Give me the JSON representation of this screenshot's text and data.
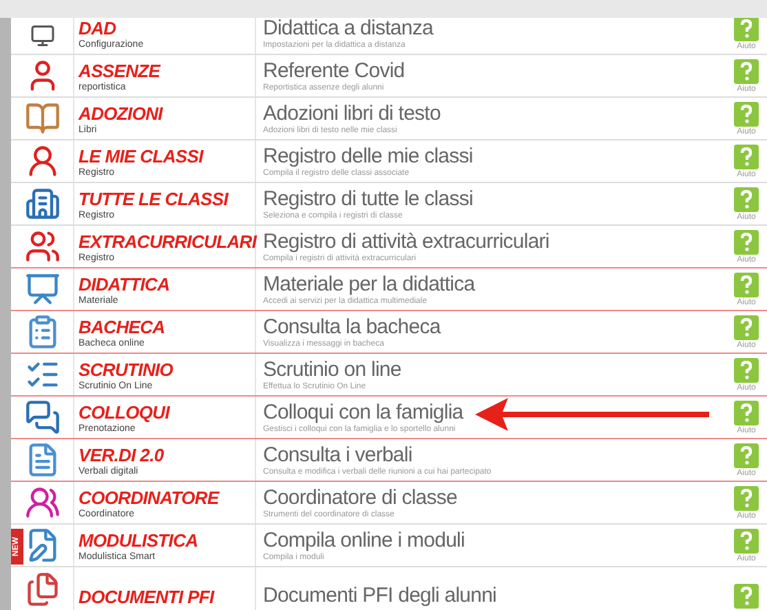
{
  "rows": [
    {
      "title": "DAD",
      "label": "Configurazione",
      "heading": "Didattica a distanza",
      "description": "Impostazioni per la didattica a distanza",
      "help": "Aiuto",
      "color": "#dddddd"
    },
    {
      "title": "ASSENZE",
      "label": "reportistica",
      "heading": "Referente Covid",
      "description": "Reportistica assenze degli alunni",
      "help": "Aiuto",
      "color": "#dddddd"
    },
    {
      "title": "ADOZIONI",
      "label": "Libri",
      "heading": "Adozioni libri di testo",
      "description": "Adozioni libri di testo nelle mie classi",
      "help": "Aiuto",
      "color": "#dddddd"
    },
    {
      "title": "LE MIE CLASSI",
      "label": "Registro",
      "heading": "Registro delle mie classi",
      "description": "Compila il registro delle classi associate",
      "help": "Aiuto",
      "color": "#dddddd"
    },
    {
      "title": "TUTTE LE CLASSI",
      "label": "Registro",
      "heading": "Registro di tutte le classi",
      "description": "Seleziona e compila i registri di classe",
      "help": "Aiuto",
      "color": "#dddddd"
    },
    {
      "title": "EXTRACURRICULARI",
      "label": "Registro",
      "heading": "Registro di attività extracurriculari",
      "description": "Compila i registri di attività extracurriculari",
      "help": "Aiuto",
      "color": "#f08a8a"
    },
    {
      "title": "DIDATTICA",
      "label": "Materiale",
      "heading": "Materiale per la didattica",
      "description": "Accedi ai servizi per la didattica multimediale",
      "help": "Aiuto",
      "color": "#f08a8a"
    },
    {
      "title": "BACHECA",
      "label": "Bacheca online",
      "heading": "Consulta la bacheca",
      "description": "Visualizza i messaggi in bacheca",
      "help": "Aiuto",
      "color": "#f08a8a"
    },
    {
      "title": "SCRUTINIO",
      "label": "Scrutinio On Line",
      "heading": "Scrutinio on line",
      "description": "Effettua lo Scrutinio On Line",
      "help": "Aiuto",
      "color": "#f08a8a"
    },
    {
      "title": "COLLOQUI",
      "label": "Prenotazione",
      "heading": "Colloqui con la famiglia",
      "description": "Gestisci i colloqui con la famiglia e lo sportello alunni",
      "help": "Aiuto",
      "color": "#f08a8a",
      "arrow": true
    },
    {
      "title": "VER.DI 2.0",
      "label": "Verbali digitali",
      "heading": "Consulta i verbali",
      "description": "Consulta e modifica i verbali delle riunioni a cui hai partecipato",
      "help": "Aiuto",
      "color": "#f08a8a"
    },
    {
      "title": "COORDINATORE",
      "label": "Coordinatore",
      "heading": "Coordinatore di classe",
      "description": "Strumenti del coordinatore di classe",
      "help": "Aiuto",
      "color": "#dddddd"
    },
    {
      "title": "MODULISTICA",
      "label": "Modulistica Smart",
      "heading": "Compila online i moduli",
      "description": "Compila i moduli",
      "help": "Aiuto",
      "color": "#dddddd",
      "badge": "NEW"
    },
    {
      "title": "DOCUMENTI PFI",
      "heading": "Documenti PFI degli alunni",
      "color": "#dddddd"
    }
  ]
}
